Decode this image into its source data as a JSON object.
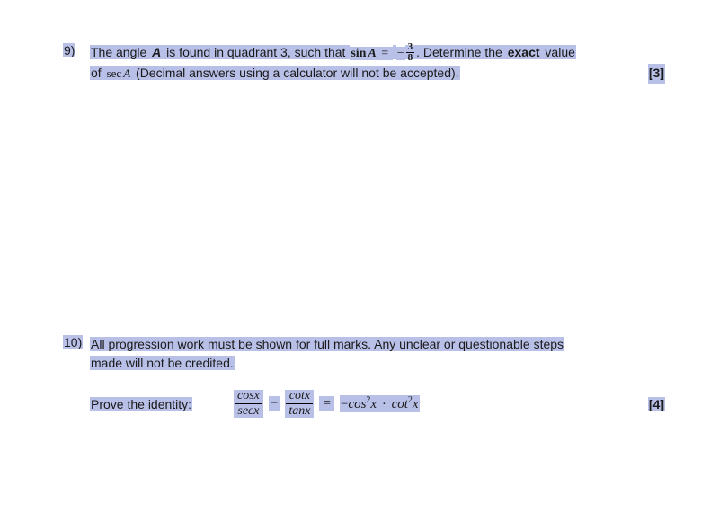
{
  "q9": {
    "number": "9)",
    "line1_a": "The angle ",
    "line1_b": "A",
    "line1_c": " is found in quadrant 3, such that ",
    "line1_sin": "sin",
    "line1_A2": "A",
    "line1_eq": " = ",
    "line1_neg": "−",
    "frac_num": "3",
    "frac_den": "8",
    "line1_d": ". Determine the ",
    "line1_exact": "exact",
    "line1_e": " value",
    "line2_a": "of ",
    "line2_sec": "sec",
    "line2_A": "A",
    "line2_b": " (Decimal answers using a calculator will not be accepted).",
    "marks": "[3]"
  },
  "q10": {
    "number": "10)",
    "line1": "All progression work must be shown for full marks. Any unclear or questionable steps",
    "line2": "made will not be credited.",
    "prove_label": "Prove the identity:",
    "lhs_f1_num": "cosx",
    "lhs_f1_den": "secx",
    "minus": "−",
    "lhs_f2_num": "cotx",
    "lhs_f2_den": "tanx",
    "eq": "=",
    "rhs_neg": "−",
    "rhs_cos": "cos",
    "rhs_sq1": "2",
    "rhs_x1": "x",
    "rhs_dot": "·",
    "rhs_cot": "cot",
    "rhs_sq2": "2",
    "rhs_x2": "x",
    "marks": "[4]"
  }
}
